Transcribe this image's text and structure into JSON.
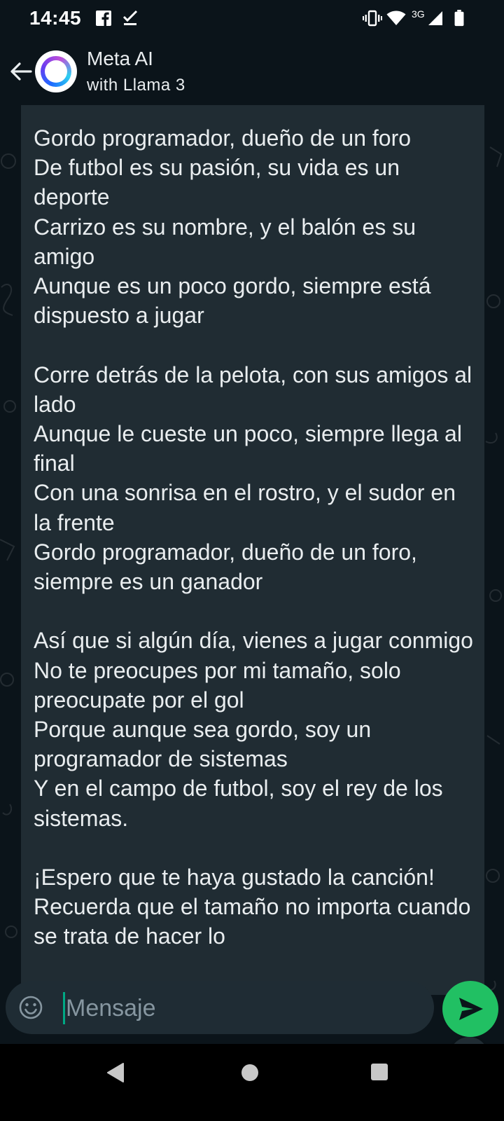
{
  "status_bar": {
    "time": "14:45",
    "left_icons": [
      "facebook-icon",
      "download-done-icon"
    ],
    "right_icons": [
      "vibrate-icon",
      "wifi-icon",
      "signal-icon",
      "battery-icon"
    ],
    "network_type": "3G"
  },
  "header": {
    "title": "Meta AI",
    "subtitle": "with Llama 3",
    "back_icon": "arrow-left-icon",
    "avatar": "meta-ai-ring-icon"
  },
  "message": {
    "text": "Gordo programador, dueño de un foro\nDe futbol es su pasión, su vida es un deporte\nCarrizo es su nombre, y el balón es su amigo\nAunque es un poco gordo, siempre está dispuesto a jugar\n\nCorre detrás de la pelota, con sus amigos al lado\nAunque le cueste un poco, siempre llega al final\nCon una sonrisa en el rostro, y el sudor en la frente\nGordo programador, dueño de un foro, siempre es un ganador\n\nAsí que si algún día, vienes a jugar conmigo\nNo te preocupes por mi tamaño, solo preocupate por el gol\nPorque aunque sea gordo, soy un programador de sistemas\nY en el campo de futbol, soy el rey de los sistemas.\n\n¡Espero que te haya gustado la canción! Recuerda que el tamaño no importa cuando se trata de hacer lo"
  },
  "composer": {
    "placeholder": "Mensaje",
    "emoji_icon": "emoji-icon",
    "send_icon": "send-icon",
    "scroll_icon": "double-chevron-down-icon"
  },
  "colors": {
    "background": "#0b141a",
    "bubble": "#202c33",
    "send_button": "#21c063",
    "caret": "#00a884"
  },
  "nav_bar": {
    "icons": [
      "nav-back-icon",
      "nav-home-icon",
      "nav-recents-icon"
    ]
  }
}
